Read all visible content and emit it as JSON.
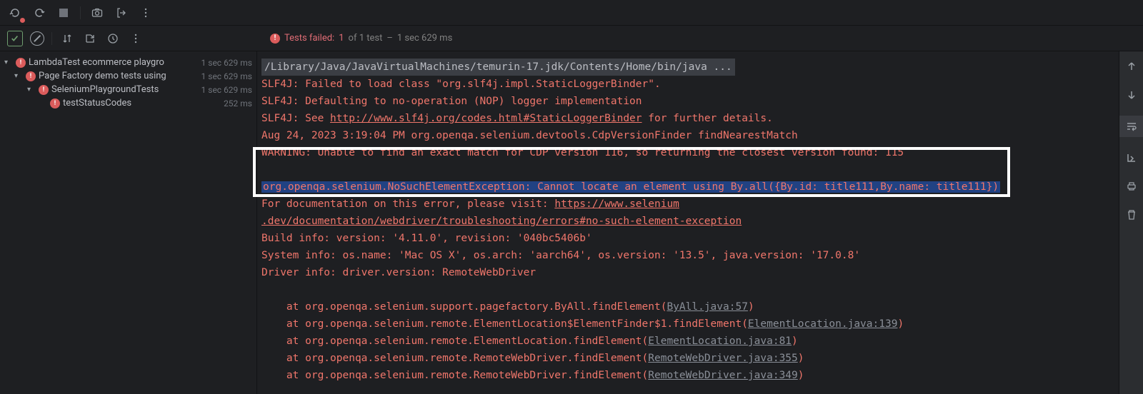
{
  "status": {
    "label": "Tests failed:",
    "failed": "1",
    "of_text": "of 1 test",
    "duration_sep": "–",
    "duration": "1 sec 629 ms"
  },
  "tree": {
    "items": [
      {
        "label": "LambdaTest ecommerce playgro",
        "time": "1 sec 629 ms",
        "indent": 0
      },
      {
        "label": "Page Factory demo tests using",
        "time": "1 sec 629 ms",
        "indent": 1
      },
      {
        "label": "SeleniumPlaygroundTests",
        "time": "1 sec 629 ms",
        "indent": 2
      },
      {
        "label": "testStatusCodes",
        "time": "252 ms",
        "indent": 3
      }
    ]
  },
  "console": {
    "cmd": "/Library/Java/JavaVirtualMachines/temurin-17.jdk/Contents/Home/bin/java ...",
    "l1": "SLF4J: Failed to load class \"org.slf4j.impl.StaticLoggerBinder\".",
    "l2": "SLF4J: Defaulting to no-operation (NOP) logger implementation",
    "l3a": "SLF4J: See ",
    "l3link": "http://www.slf4j.org/codes.html#StaticLoggerBinder",
    "l3b": " for further details.",
    "l4": "Aug 24, 2023 3:19:04 PM org.openqa.selenium.devtools.CdpVersionFinder findNearestMatch",
    "l5": "WARNING: Unable to find an exact match for CDP version 116, so returning the closest version found: 115",
    "exc": "org.openqa.selenium.NoSuchElementException: Cannot locate an element using By.all({By.id: title111,By.name: title111})",
    "doc_a": "For documentation on this error, please visit: ",
    "doc_link1": "https://www.selenium",
    "doc_link2": ".dev/documentation/webdriver/troubleshooting/errors#no-such-element-exception",
    "build": "Build info: version: '4.11.0', revision: '040bc5406b'",
    "system": "System info: os.name: 'Mac OS X', os.arch: 'aarch64', os.version: '13.5', java.version: '17.0.8'",
    "driver": "Driver info: driver.version: RemoteWebDriver",
    "stack": [
      {
        "pre": "    at org.openqa.selenium.support.pagefactory.ByAll.findElement(",
        "link": "ByAll.java:57",
        "post": ")"
      },
      {
        "pre": "    at org.openqa.selenium.remote.ElementLocation$ElementFinder$1.findElement(",
        "link": "ElementLocation.java:139",
        "post": ")"
      },
      {
        "pre": "    at org.openqa.selenium.remote.ElementLocation.findElement(",
        "link": "ElementLocation.java:81",
        "post": ")"
      },
      {
        "pre": "    at org.openqa.selenium.remote.RemoteWebDriver.findElement(",
        "link": "RemoteWebDriver.java:355",
        "post": ")"
      },
      {
        "pre": "    at org.openqa.selenium.remote.RemoteWebDriver.findElement(",
        "link": "RemoteWebDriver.java:349",
        "post": ")"
      }
    ]
  }
}
